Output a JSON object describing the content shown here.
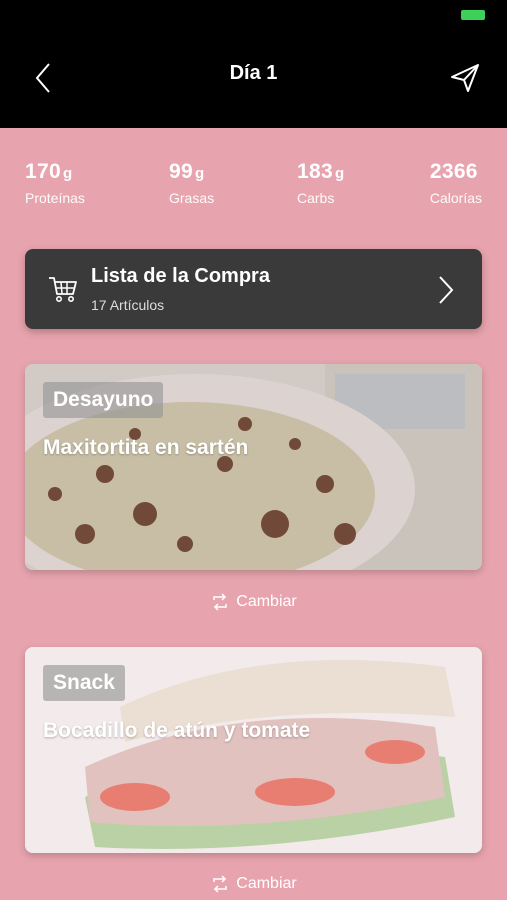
{
  "header": {
    "title": "Día 1"
  },
  "macros": [
    {
      "value": "170",
      "unit": "g",
      "label": "Proteínas"
    },
    {
      "value": "99",
      "unit": "g",
      "label": "Grasas"
    },
    {
      "value": "183",
      "unit": "g",
      "label": "Carbs"
    },
    {
      "value": "2366",
      "unit": "",
      "label": "Calorías"
    }
  ],
  "shopping_list": {
    "title": "Lista de la Compra",
    "count": "17 Artículos",
    "icon": "cart-icon"
  },
  "meals": [
    {
      "tag": "Desayuno",
      "name": "Maxitortita en sartén",
      "swap_label": "Cambiar"
    },
    {
      "tag": "Snack",
      "name": "Bocadillo de atún y tomate",
      "swap_label": "Cambiar"
    }
  ],
  "colors": {
    "background": "#e8a4ae",
    "header": "#000000",
    "card": "#3a3a3a",
    "battery": "#3ed15a"
  }
}
